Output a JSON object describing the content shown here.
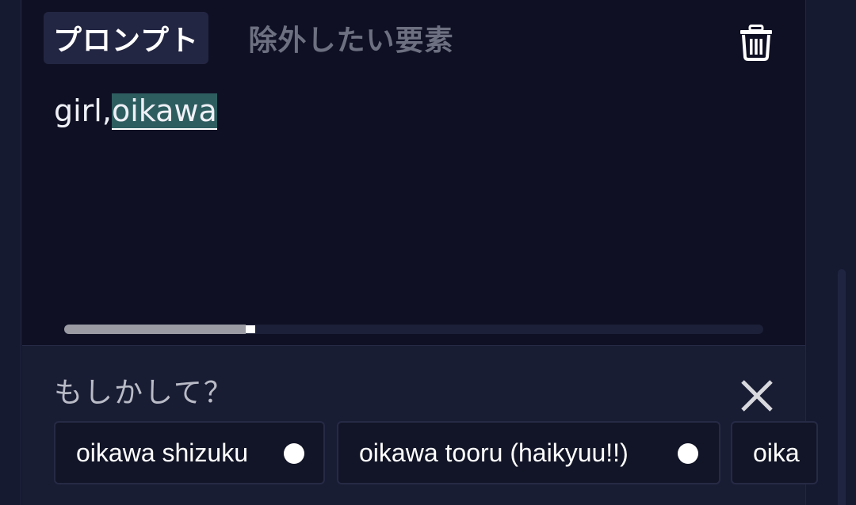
{
  "tabs": [
    {
      "label": "プロンプト",
      "active": true
    },
    {
      "label": "除外したい要素",
      "active": false
    }
  ],
  "prompt": {
    "prefix": "girl,",
    "highlighted": "oikawa",
    "scroll_progress": 0.26
  },
  "suggestions": {
    "title": "もしかして？",
    "items": [
      {
        "label": "oikawa shizuku"
      },
      {
        "label": "oikawa tooru (haikyuu!!)"
      },
      {
        "label": "oika"
      }
    ]
  },
  "icons": {
    "trash": "trash-icon",
    "close": "close-icon",
    "status_dot": "dot-icon"
  },
  "colors": {
    "background": "#0f1024",
    "active_tab": "#232642",
    "highlight": "#2e5d5f",
    "inactive_text": "#6d7080"
  }
}
